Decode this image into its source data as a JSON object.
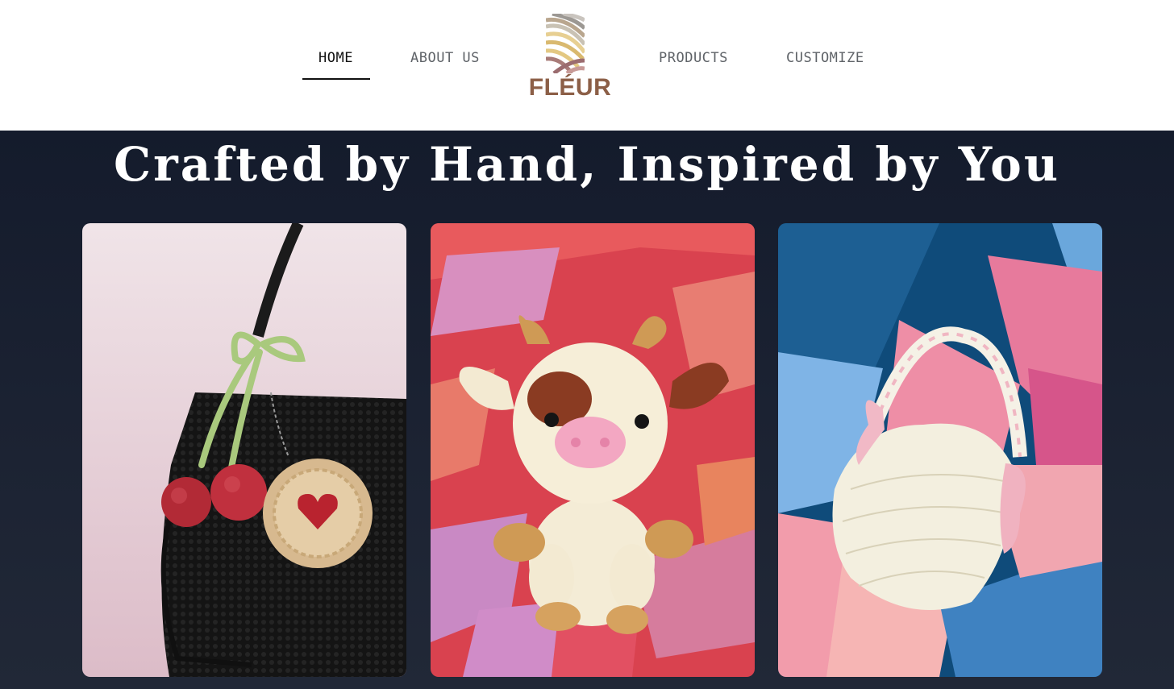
{
  "nav": {
    "home": "HOME",
    "about": "ABOUT US",
    "products": "PRODUCTS",
    "customize": "CUSTOMIZE",
    "active": "home"
  },
  "logo": {
    "text": "FLÉUR",
    "icon": "arc-stripes-logo-icon"
  },
  "hero": {
    "title": "Crafted by Hand, Inspired by You"
  },
  "products": [
    {
      "image": "crochet-black-bag-with-cherries"
    },
    {
      "image": "crochet-cow-plush"
    },
    {
      "image": "crochet-white-bag-with-pink-bows"
    }
  ],
  "colors": {
    "hero_bg": "#141b2c",
    "nav_text": "#5f6368",
    "nav_active": "#111111",
    "logo_brand": "#8c5f47"
  }
}
